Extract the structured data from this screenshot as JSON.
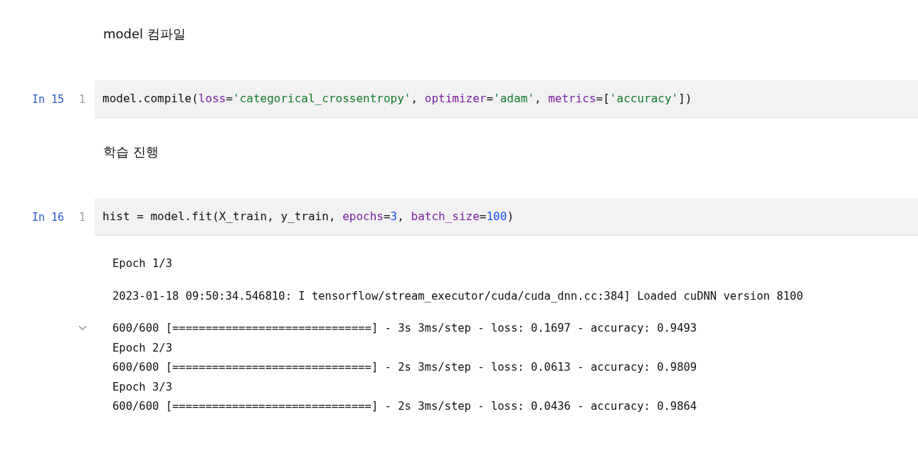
{
  "cells": [
    {
      "kind": "markdown",
      "text": "model 컴파일"
    },
    {
      "kind": "code",
      "prompt": "In 15",
      "lines": [
        {
          "number": "1",
          "tokens": [
            {
              "kind": "plain",
              "text": "model.compile("
            },
            {
              "kind": "param",
              "text": "loss"
            },
            {
              "kind": "plain",
              "text": "="
            },
            {
              "kind": "string",
              "text": "'categorical_crossentropy'"
            },
            {
              "kind": "plain",
              "text": ", "
            },
            {
              "kind": "param",
              "text": "optimizer"
            },
            {
              "kind": "plain",
              "text": "="
            },
            {
              "kind": "string",
              "text": "'adam'"
            },
            {
              "kind": "plain",
              "text": ", "
            },
            {
              "kind": "param",
              "text": "metrics"
            },
            {
              "kind": "plain",
              "text": "=["
            },
            {
              "kind": "string",
              "text": "'accuracy'"
            },
            {
              "kind": "plain",
              "text": "])"
            }
          ]
        }
      ]
    },
    {
      "kind": "markdown",
      "text": "학습 진행"
    },
    {
      "kind": "code",
      "prompt": "In 16",
      "lines": [
        {
          "number": "1",
          "tokens": [
            {
              "kind": "plain",
              "text": "hist = model.fit(X_train, y_train, "
            },
            {
              "kind": "param",
              "text": "epochs"
            },
            {
              "kind": "plain",
              "text": "="
            },
            {
              "kind": "number",
              "text": "3"
            },
            {
              "kind": "plain",
              "text": ", "
            },
            {
              "kind": "param",
              "text": "batch_size"
            },
            {
              "kind": "plain",
              "text": "="
            },
            {
              "kind": "number",
              "text": "100"
            },
            {
              "kind": "plain",
              "text": ")"
            }
          ]
        }
      ],
      "outputs": [
        {
          "expanded": false,
          "lines": [
            "Epoch 1/3"
          ]
        },
        {
          "expanded": false,
          "lines": [
            "2023-01-18 09:50:34.546810: I tensorflow/stream_executor/cuda/cuda_dnn.cc:384] Loaded cuDNN version 8100"
          ]
        },
        {
          "expanded": true,
          "lines": [
            "600/600 [==============================] - 3s 3ms/step - loss: 0.1697 - accuracy: 0.9493",
            "Epoch 2/3",
            "600/600 [==============================] - 2s 3ms/step - loss: 0.0613 - accuracy: 0.9809",
            "Epoch 3/3",
            "600/600 [==============================] - 2s 3ms/step - loss: 0.0436 - accuracy: 0.9864"
          ]
        }
      ]
    }
  ]
}
